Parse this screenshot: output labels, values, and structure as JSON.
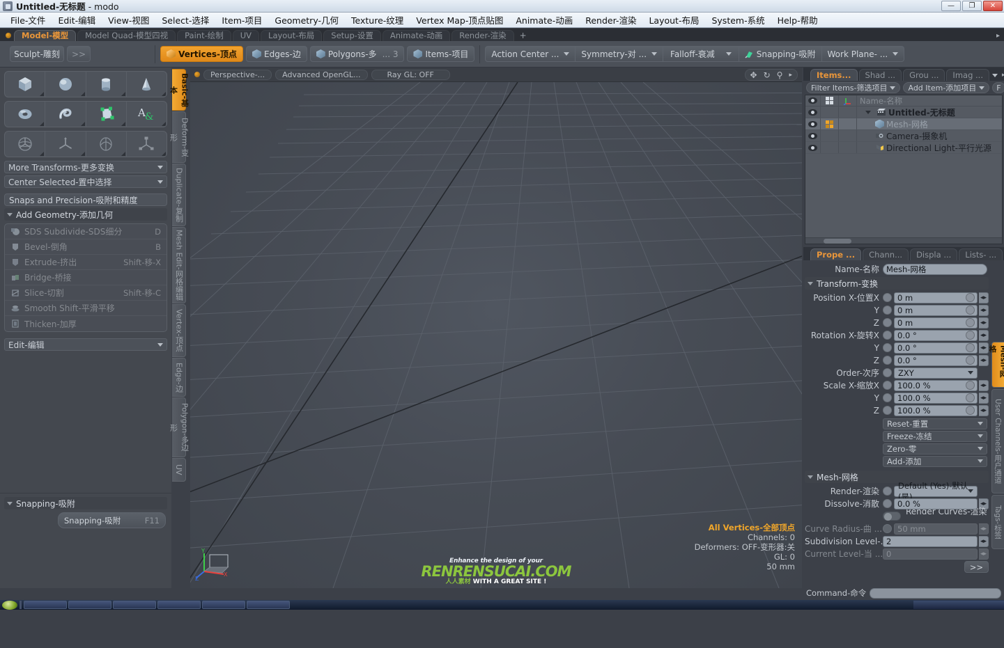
{
  "window": {
    "title_main": "Untitled-无标题",
    "title_app": " - modo",
    "buttons": [
      "—",
      "❐",
      "✕"
    ]
  },
  "menubar": {
    "items": [
      "File-文件",
      "Edit-编辑",
      "View-视图",
      "Select-选择",
      "Item-项目",
      "Geometry-几何",
      "Texture-纹理",
      "Vertex Map-顶点贴图",
      "Animate-动画",
      "Render-渲染",
      "Layout-布局",
      "System-系统",
      "Help-帮助"
    ]
  },
  "layout_tabs": {
    "items": [
      {
        "label": "Model-模型",
        "active": true
      },
      {
        "label": "Model Quad-模型四视",
        "active": false
      },
      {
        "label": "Paint-绘制",
        "active": false
      },
      {
        "label": "UV",
        "active": false
      },
      {
        "label": "Layout-布局",
        "active": false
      },
      {
        "label": "Setup-设置",
        "active": false
      },
      {
        "label": "Animate-动画",
        "active": false
      },
      {
        "label": "Render-渲染",
        "active": false
      }
    ],
    "add_label": "+"
  },
  "modebar": {
    "sculpt_label": "Sculpt-雕刻",
    "expand_label": ">>",
    "selection_modes": [
      {
        "label": "Vertices-顶点",
        "active": true
      },
      {
        "label": "Edges-边",
        "active": false
      },
      {
        "label": "Polygons-多",
        "active": false
      }
    ],
    "polygons_extra": "... 3",
    "items_mode": "Items-项目",
    "action_center": "Action Center ...",
    "symmetry": "Symmetry-对 ...",
    "falloff": "Falloff-衰减",
    "snapping": "Snapping-吸附",
    "work_plane": "Work Plane-  ..."
  },
  "toolbox": {
    "shapes": [
      [
        {
          "name": "cube-primitive-icon",
          "shape": "cube"
        },
        {
          "name": "sphere-primitive-icon",
          "shape": "sphere"
        },
        {
          "name": "cylinder-primitive-icon",
          "shape": "cylinder"
        },
        {
          "name": "cone-primitive-icon",
          "shape": "cone"
        }
      ],
      [
        {
          "name": "torus-primitive-icon",
          "shape": "torus"
        },
        {
          "name": "spiral-primitive-icon",
          "shape": "spiral"
        },
        {
          "name": "polygon-pen-icon",
          "shape": "pen"
        },
        {
          "name": "text-tool-icon",
          "shape": "text"
        }
      ],
      [
        {
          "name": "rotate-transform-icon",
          "shape": "rotate"
        },
        {
          "name": "move-transform-icon",
          "shape": "move"
        },
        {
          "name": "scale-transform-icon",
          "shape": "scale"
        },
        {
          "name": "transform-tool-icon",
          "shape": "transform"
        }
      ]
    ],
    "more_transforms": "More Transforms-更多变换",
    "center_selected": "Center Selected-置中选择",
    "snaps_precision": "Snaps and Precision-吸附和精度",
    "add_geometry": "Add Geometry-添加几何",
    "geometry_items": [
      {
        "label": "SDS Subdivide-SDS细分",
        "key": "D"
      },
      {
        "label": "Bevel-倒角",
        "key": "B"
      },
      {
        "label": "Extrude-挤出",
        "key": "Shift-移-X"
      },
      {
        "label": "Bridge-桥接",
        "key": ""
      },
      {
        "label": "Slice-切割",
        "key": "Shift-移-C"
      },
      {
        "label": "Smooth Shift-平滑平移",
        "key": ""
      },
      {
        "label": "Thicken-加厚",
        "key": ""
      }
    ],
    "edit_label": "Edit-编辑",
    "snapping_header": "Snapping-吸附",
    "snapping_button": "Snapping-吸附",
    "snapping_key": "F11"
  },
  "vertical_tabs": {
    "items": [
      {
        "label": "Basic-基本",
        "active": true
      },
      {
        "label": "Deform-变形",
        "active": false
      },
      {
        "label": "Duplicate-复制",
        "active": false
      },
      {
        "label": "Mesh Edit-网格编辑",
        "active": false
      },
      {
        "label": "Vertex-顶点",
        "active": false
      },
      {
        "label": "Edge-边",
        "active": false
      },
      {
        "label": "Polygon-多边形",
        "active": false
      },
      {
        "label": "UV",
        "active": false
      }
    ]
  },
  "viewport": {
    "view_label": "Perspective-...",
    "shading_label": "Advanced OpenGL...",
    "raygl_label": "Ray GL: OFF",
    "tool_icons": [
      "move-icon",
      "rotate-icon",
      "zoom-icon",
      "chevron-right-icon"
    ],
    "info": {
      "selection": "All Vertices-全部顶点",
      "channels": "Channels: 0",
      "deformers": "Deformers: OFF-变形器:关",
      "gl": "GL: 0",
      "scale": "50 mm"
    },
    "axis_labels": {
      "x": "X",
      "y": "Y",
      "z": "Z"
    },
    "watermark": {
      "line1": "Enhance the design of your",
      "line2": "RENRENSUCAI.COM",
      "line3_cn": "人人素材",
      "line3_en": "WITH A GREAT SITE !"
    }
  },
  "right_panel": {
    "top_tabs": [
      {
        "label": "Items...",
        "active": true
      },
      {
        "label": "Shad ...",
        "active": false
      },
      {
        "label": "Grou ...",
        "active": false
      },
      {
        "label": "Imag ...",
        "active": false
      }
    ],
    "filter_items": "Filter Items-筛选项目",
    "add_item": "Add Item-添加项目",
    "f_button": "F",
    "tree_header": {
      "name": "Name-名称"
    },
    "tree_rows": [
      {
        "label": "Untitled-无标题",
        "indent": 0,
        "icon": "scene-icon",
        "selected": false,
        "expanded": true,
        "bold": true,
        "quad": false
      },
      {
        "label": "Mesh-网格",
        "indent": 1,
        "icon": "mesh-icon",
        "selected": true,
        "expanded": false,
        "bold": false,
        "quad": true
      },
      {
        "label": "Camera-摄象机",
        "indent": 1,
        "icon": "camera-icon",
        "selected": false,
        "expanded": false,
        "bold": false,
        "quad": false
      },
      {
        "label": "Directional Light-平行光源",
        "indent": 1,
        "icon": "light-icon",
        "selected": false,
        "expanded": false,
        "bold": false,
        "quad": false
      }
    ],
    "prop_tabs": [
      {
        "label": "Prope ...",
        "active": true
      },
      {
        "label": "Chann...",
        "active": false
      },
      {
        "label": "Displa ...",
        "active": false
      },
      {
        "label": "Lists-  ...",
        "active": false
      }
    ],
    "prop_tabs_plus": "+",
    "properties": {
      "name_label": "Name-名称",
      "name_value": "Mesh-网格",
      "transform_header": "Transform-变换",
      "position": {
        "label_x": "Position X-位置X",
        "label_y": "Y",
        "label_z": "Z",
        "x": "0 m",
        "y": "0 m",
        "z": "0 m"
      },
      "rotation": {
        "label_x": "Rotation X-旋转X",
        "label_y": "Y",
        "label_z": "Z",
        "x": "0.0 °",
        "y": "0.0 °",
        "z": "0.0 °"
      },
      "order_label": "Order-次序",
      "order_value": "ZXY",
      "scale": {
        "label_x": "Scale X-缩放X",
        "label_y": "Y",
        "label_z": "Z",
        "x": "100.0 %",
        "y": "100.0 %",
        "z": "100.0 %"
      },
      "actions": [
        "Reset-重置",
        "Freeze-冻结",
        "Zero-零",
        "Add-添加"
      ],
      "mesh_header": "Mesh-网格",
      "render_label": "Render-渲染",
      "render_value": "Default (Yes)-默认(是)",
      "dissolve_label": "Dissolve-消散",
      "dissolve_value": "0.0 %",
      "render_curves_label": "Render Curves-渲染 ...",
      "curve_radius_label": "Curve Radius-曲  ...",
      "curve_radius_value": "50 mm",
      "subdiv_label": "Subdivision Level-...",
      "subdiv_value": "2",
      "current_level_label": "Current Level-当  ...",
      "current_level_value": "0",
      "more_button": ">>"
    },
    "side_tabs": [
      {
        "label": "Mesh-网格",
        "active": true
      },
      {
        "label": "User Channels-用户通道",
        "active": false
      },
      {
        "label": "Tags-标签",
        "active": false
      }
    ],
    "command_label": "Command-命令",
    "command_value": ""
  },
  "colors": {
    "accent_orange": "#f0a62a",
    "panel_bg": "#44484f",
    "viewport_bg": "#4a4e56",
    "field_bg": "#9aa3ae",
    "watermark_green": "#8cc63e"
  }
}
